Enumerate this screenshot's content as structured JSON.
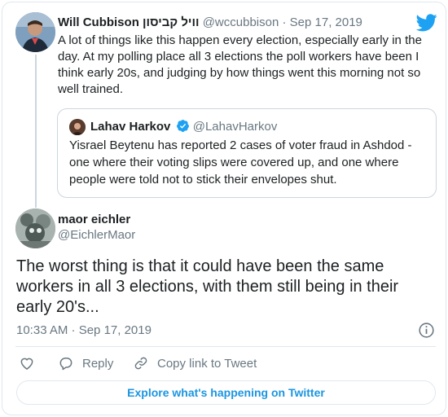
{
  "parent_tweet": {
    "display_name": "Will Cubbison וויל קביסון",
    "handle": "@wccubbison",
    "separator": "·",
    "date": "Sep 17, 2019",
    "text": "A lot of things like this happen every election, especially early in the day. At my polling place all 3 elections the poll workers have been I think early 20s, and judging by how things went this morning not so well trained."
  },
  "quoted_tweet": {
    "display_name": "Lahav Harkov",
    "handle": "@LahavHarkov",
    "text": "Yisrael Beytenu has reported 2 cases of voter fraud in Ashdod - one where their voting slips were covered up, and one where people were told not to stick their envelopes shut."
  },
  "main_tweet": {
    "display_name": "maor eichler",
    "handle": "@EichlerMaor",
    "text": "The worst thing is that it could have been the same workers in all 3 elections, with them still being in their early 20's...",
    "timestamp": "10:33 AM · Sep 17, 2019"
  },
  "actions": {
    "reply_label": "Reply",
    "copy_label": "Copy link to Tweet"
  },
  "explore_label": "Explore what's happening on Twitter",
  "colors": {
    "twitter_blue": "#1da1f2",
    "link_blue": "#1b95e0",
    "muted_gray": "#697882",
    "border": "#e1e8ed"
  },
  "icons": [
    "twitter-bird-icon",
    "verified-badge-icon",
    "info-icon",
    "heart-icon",
    "reply-icon",
    "link-icon"
  ]
}
